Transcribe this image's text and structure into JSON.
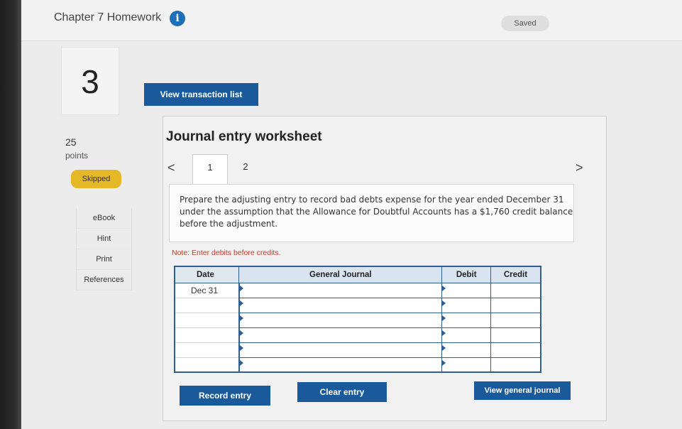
{
  "header": {
    "title": "Chapter 7 Homework",
    "info_icon": "i",
    "saved_label": "Saved"
  },
  "question": {
    "number": "3",
    "points_value": "25",
    "points_label": "points",
    "status": "Skipped"
  },
  "side_links": [
    "eBook",
    "Hint",
    "Print",
    "References"
  ],
  "buttons": {
    "view_transactions": "View transaction list",
    "record_entry": "Record entry",
    "clear_entry": "Clear entry",
    "view_general_journal": "View general journal"
  },
  "worksheet": {
    "title": "Journal entry worksheet",
    "prev_icon": "<",
    "next_icon": ">",
    "tabs": [
      "1",
      "2"
    ],
    "instructions": "Prepare the adjusting entry to record bad debts expense for the year ended December 31 under the assumption that the Allowance for Doubtful Accounts has a $1,760 credit balance before the adjustment.",
    "note": "Note: Enter debits before credits."
  },
  "journal": {
    "columns": [
      "Date",
      "General Journal",
      "Debit",
      "Credit"
    ],
    "rows": [
      {
        "date": "Dec 31",
        "account": "",
        "debit": "",
        "credit": ""
      },
      {
        "date": "",
        "account": "",
        "debit": "",
        "credit": ""
      },
      {
        "date": "",
        "account": "",
        "debit": "",
        "credit": ""
      },
      {
        "date": "",
        "account": "",
        "debit": "",
        "credit": ""
      },
      {
        "date": "",
        "account": "",
        "debit": "",
        "credit": ""
      },
      {
        "date": "",
        "account": "",
        "debit": "",
        "credit": ""
      }
    ]
  },
  "colors": {
    "primary_button": "#1a5a9a",
    "skipped_badge": "#e5b827",
    "note_text": "#b93a2a",
    "table_border": "#2f5e8f"
  }
}
